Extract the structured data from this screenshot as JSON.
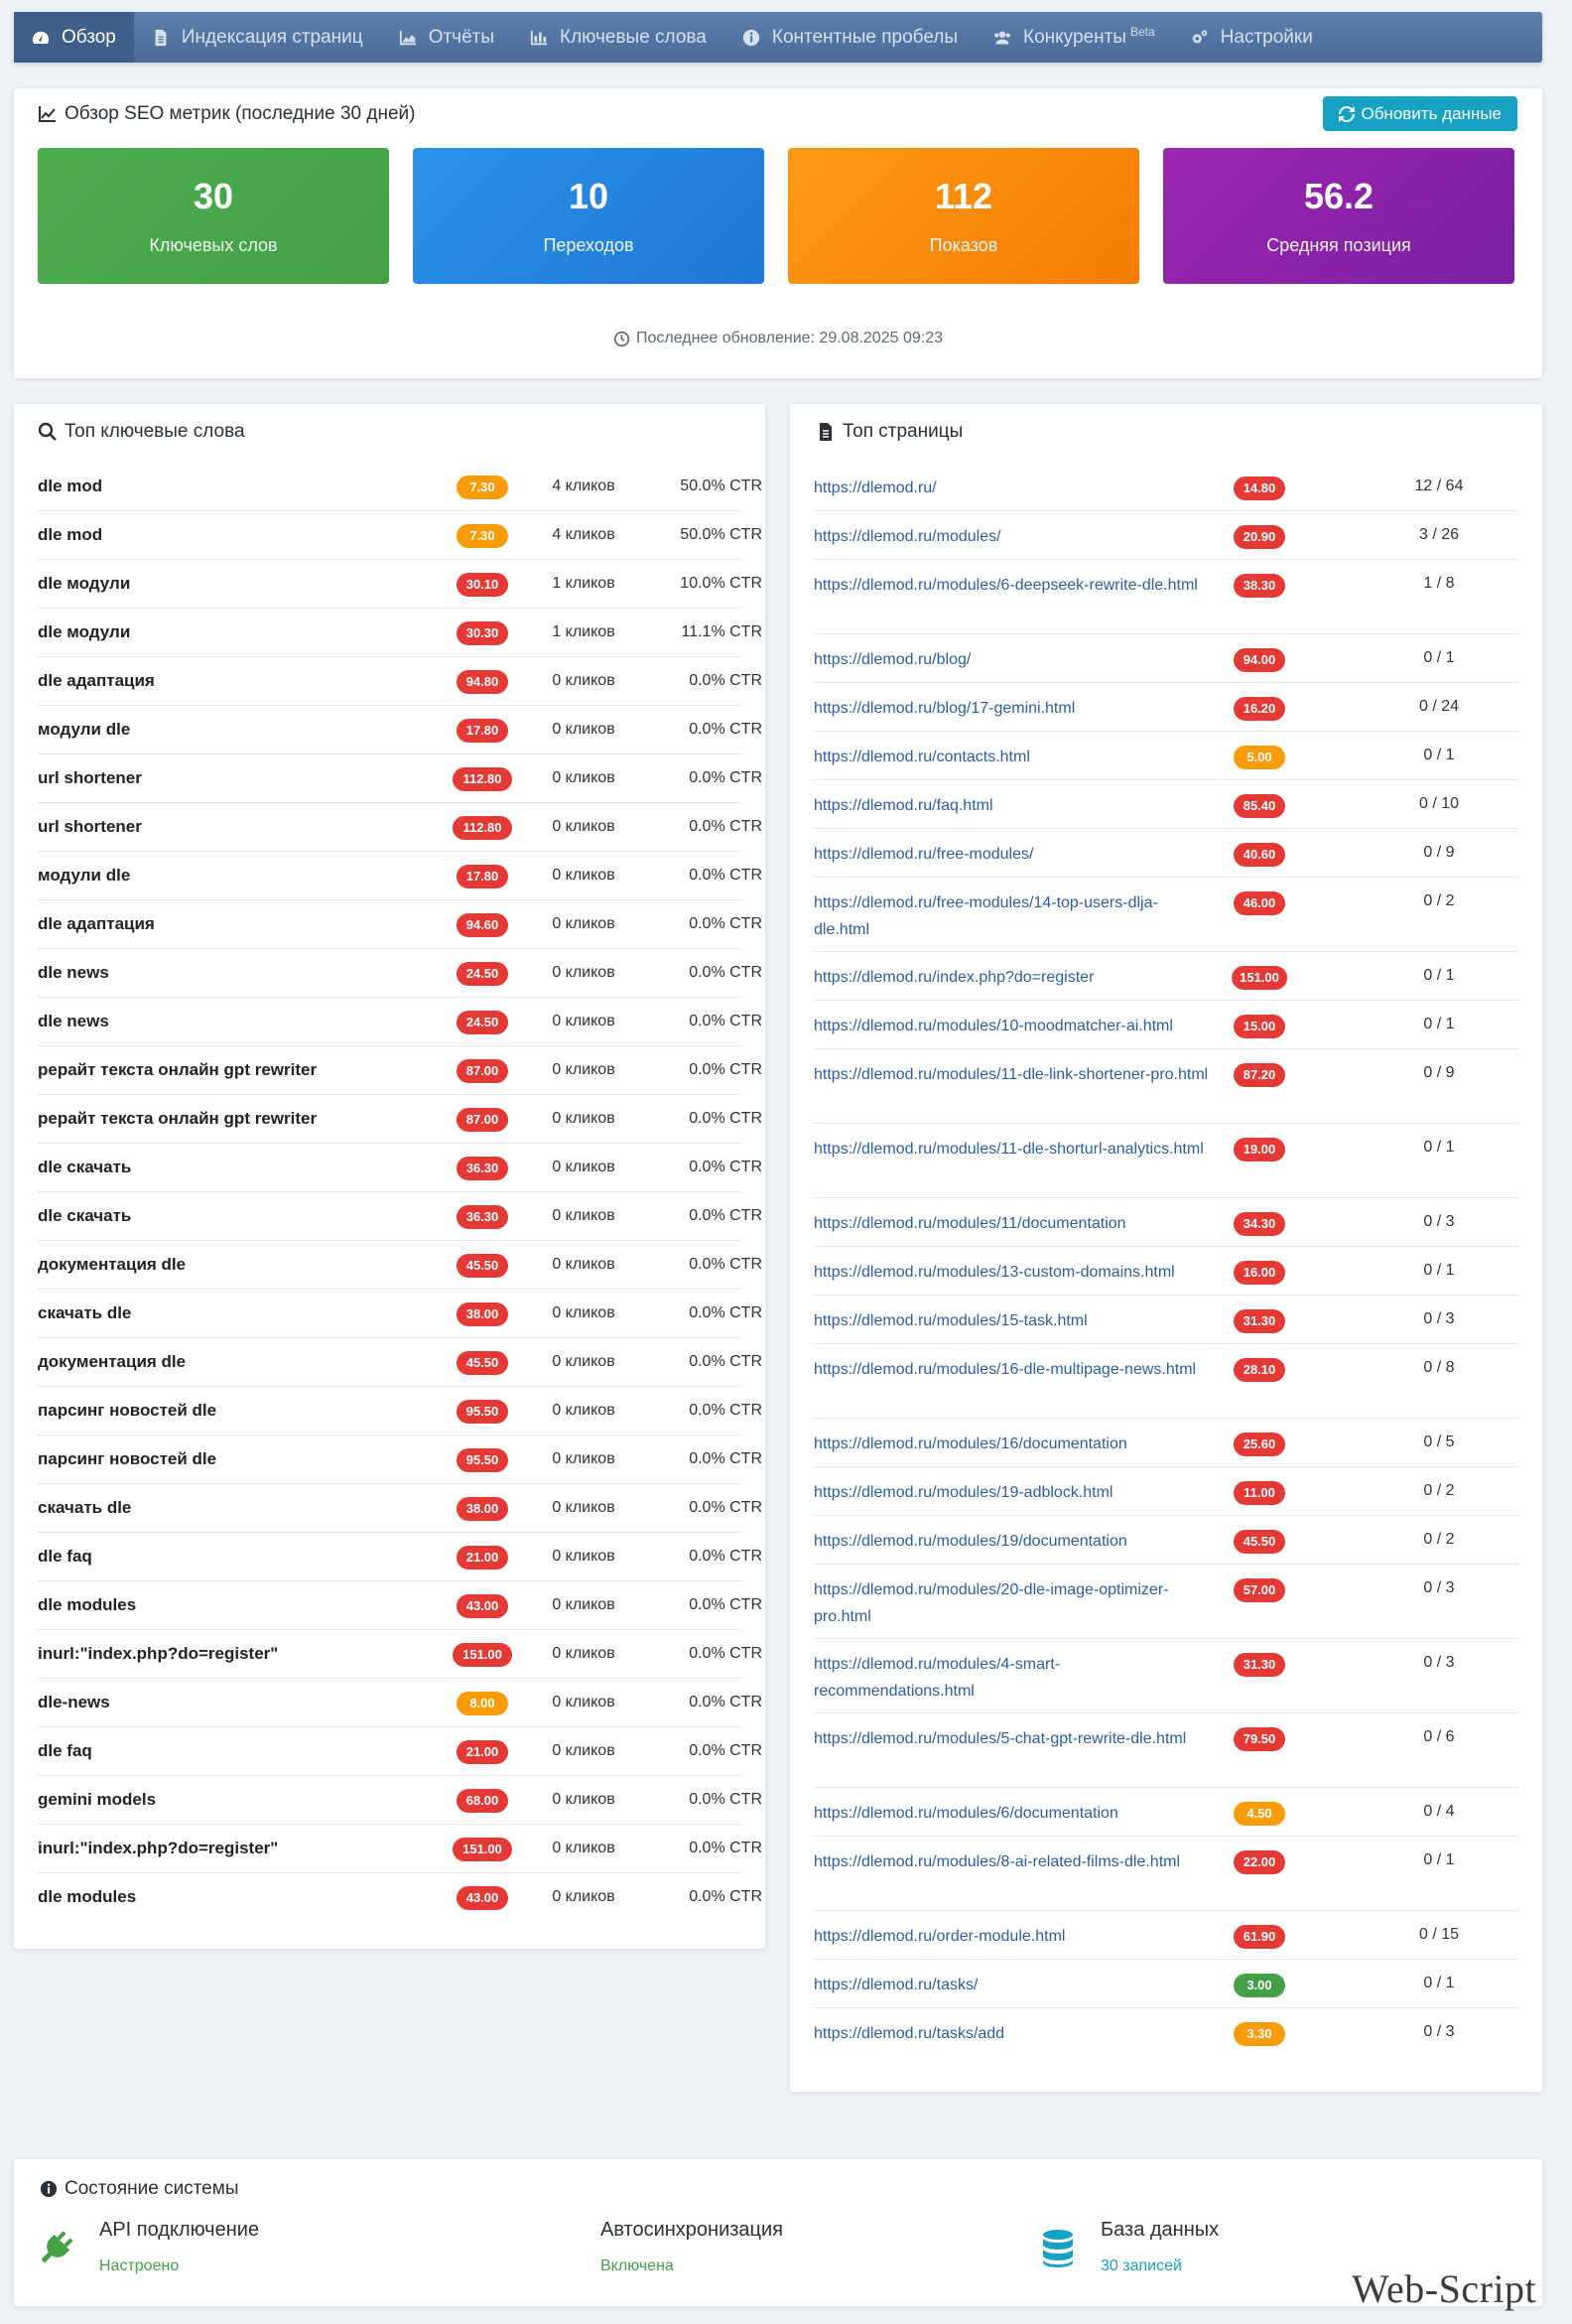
{
  "nav": {
    "items": [
      {
        "label": "Обзор",
        "icon": "dashboard-icon",
        "active": true
      },
      {
        "label": "Индексация страниц",
        "icon": "file-icon"
      },
      {
        "label": "Отчёты",
        "icon": "area-chart-icon"
      },
      {
        "label": "Ключевые слова",
        "icon": "bar-chart-icon"
      },
      {
        "label": "Контентные пробелы",
        "icon": "info-circle-icon"
      },
      {
        "label": "Конкуренты",
        "icon": "users-icon",
        "sup": "Beta"
      },
      {
        "label": "Настройки",
        "icon": "cogs-icon"
      }
    ]
  },
  "metrics": {
    "title": "Обзор SEO метрик (последние 30 дней)",
    "refresh_label": "Обновить данные",
    "updated": "Последнее обновление: 29.08.2025 09:23",
    "cards": [
      {
        "value": "30",
        "label": "Ключевых слов",
        "color_from": "#4cae4f",
        "color_to": "#43a047"
      },
      {
        "value": "10",
        "label": "Переходов",
        "color_from": "#2a93e8",
        "color_to": "#1e78d3"
      },
      {
        "value": "112",
        "label": "Показов",
        "color_from": "#ff9a17",
        "color_to": "#f57c00"
      },
      {
        "value": "56.2",
        "label": "Средняя позиция",
        "color_from": "#9c27b0",
        "color_to": "#7b1fa2"
      }
    ]
  },
  "colors": {
    "red": "#e53935",
    "orange": "#fb9c06",
    "green": "#43a047",
    "link": "#2a5ea7"
  },
  "keywords": {
    "title": "Топ ключевые слова",
    "rows": [
      {
        "name": "dle mod",
        "pos": "7.30",
        "clicks": "4 кликов",
        "ctr": "50.0% CTR",
        "color": "orange"
      },
      {
        "name": "dle mod",
        "pos": "7.30",
        "clicks": "4 кликов",
        "ctr": "50.0% CTR",
        "color": "orange"
      },
      {
        "name": "dle модули",
        "pos": "30.10",
        "clicks": "1 кликов",
        "ctr": "10.0% CTR",
        "color": "red"
      },
      {
        "name": "dle модули",
        "pos": "30.30",
        "clicks": "1 кликов",
        "ctr": "11.1% CTR",
        "color": "red"
      },
      {
        "name": "dle адаптация",
        "pos": "94.80",
        "clicks": "0 кликов",
        "ctr": "0.0% CTR",
        "color": "red"
      },
      {
        "name": "модули dle",
        "pos": "17.80",
        "clicks": "0 кликов",
        "ctr": "0.0% CTR",
        "color": "red"
      },
      {
        "name": "url shortener",
        "pos": "112.80",
        "clicks": "0 кликов",
        "ctr": "0.0% CTR",
        "color": "red"
      },
      {
        "name": "url shortener",
        "pos": "112.80",
        "clicks": "0 кликов",
        "ctr": "0.0% CTR",
        "color": "red"
      },
      {
        "name": "модули dle",
        "pos": "17.80",
        "clicks": "0 кликов",
        "ctr": "0.0% CTR",
        "color": "red"
      },
      {
        "name": "dle адаптация",
        "pos": "94.60",
        "clicks": "0 кликов",
        "ctr": "0.0% CTR",
        "color": "red"
      },
      {
        "name": "dle news",
        "pos": "24.50",
        "clicks": "0 кликов",
        "ctr": "0.0% CTR",
        "color": "red"
      },
      {
        "name": "dle news",
        "pos": "24.50",
        "clicks": "0 кликов",
        "ctr": "0.0% CTR",
        "color": "red"
      },
      {
        "name": "рерайт текста онлайн gpt rewriter",
        "pos": "87.00",
        "clicks": "0 кликов",
        "ctr": "0.0% CTR",
        "color": "red"
      },
      {
        "name": "рерайт текста онлайн gpt rewriter",
        "pos": "87.00",
        "clicks": "0 кликов",
        "ctr": "0.0% CTR",
        "color": "red"
      },
      {
        "name": "dle скачать",
        "pos": "36.30",
        "clicks": "0 кликов",
        "ctr": "0.0% CTR",
        "color": "red"
      },
      {
        "name": "dle скачать",
        "pos": "36.30",
        "clicks": "0 кликов",
        "ctr": "0.0% CTR",
        "color": "red"
      },
      {
        "name": "документация dle",
        "pos": "45.50",
        "clicks": "0 кликов",
        "ctr": "0.0% CTR",
        "color": "red"
      },
      {
        "name": "скачать dle",
        "pos": "38.00",
        "clicks": "0 кликов",
        "ctr": "0.0% CTR",
        "color": "red"
      },
      {
        "name": "документация dle",
        "pos": "45.50",
        "clicks": "0 кликов",
        "ctr": "0.0% CTR",
        "color": "red"
      },
      {
        "name": "парсинг новостей dle",
        "pos": "95.50",
        "clicks": "0 кликов",
        "ctr": "0.0% CTR",
        "color": "red"
      },
      {
        "name": "парсинг новостей dle",
        "pos": "95.50",
        "clicks": "0 кликов",
        "ctr": "0.0% CTR",
        "color": "red"
      },
      {
        "name": "скачать dle",
        "pos": "38.00",
        "clicks": "0 кликов",
        "ctr": "0.0% CTR",
        "color": "red"
      },
      {
        "name": "dle faq",
        "pos": "21.00",
        "clicks": "0 кликов",
        "ctr": "0.0% CTR",
        "color": "red"
      },
      {
        "name": "dle modules",
        "pos": "43.00",
        "clicks": "0 кликов",
        "ctr": "0.0% CTR",
        "color": "red"
      },
      {
        "name": "inurl:\"index.php?do=register\"",
        "pos": "151.00",
        "clicks": "0 кликов",
        "ctr": "0.0% CTR",
        "color": "red"
      },
      {
        "name": "dle-news",
        "pos": "8.00",
        "clicks": "0 кликов",
        "ctr": "0.0% CTR",
        "color": "orange"
      },
      {
        "name": "dle faq",
        "pos": "21.00",
        "clicks": "0 кликов",
        "ctr": "0.0% CTR",
        "color": "red"
      },
      {
        "name": "gemini models",
        "pos": "68.00",
        "clicks": "0 кликов",
        "ctr": "0.0% CTR",
        "color": "red"
      },
      {
        "name": "inurl:\"index.php?do=register\"",
        "pos": "151.00",
        "clicks": "0 кликов",
        "ctr": "0.0% CTR",
        "color": "red"
      },
      {
        "name": "dle modules",
        "pos": "43.00",
        "clicks": "0 кликов",
        "ctr": "0.0% CTR",
        "color": "red"
      }
    ]
  },
  "pages": {
    "title": "Топ страницы",
    "rows": [
      {
        "url": "https://dlemod.ru/",
        "pos": "14.80",
        "ratio": "12 / 64",
        "color": "red"
      },
      {
        "url": "https://dlemod.ru/modules/",
        "pos": "20.90",
        "ratio": "3 / 26",
        "color": "red"
      },
      {
        "url": "https://dlemod.ru/modules/6-deepseek-rewrite-dle.html",
        "pos": "38.30",
        "ratio": "1 / 8",
        "color": "red"
      },
      {
        "url": "https://dlemod.ru/blog/",
        "pos": "94.00",
        "ratio": "0 / 1",
        "color": "red"
      },
      {
        "url": "https://dlemod.ru/blog/17-gemini.html",
        "pos": "16.20",
        "ratio": "0 / 24",
        "color": "red"
      },
      {
        "url": "https://dlemod.ru/contacts.html",
        "pos": "5.00",
        "ratio": "0 / 1",
        "color": "orange"
      },
      {
        "url": "https://dlemod.ru/faq.html",
        "pos": "85.40",
        "ratio": "0 / 10",
        "color": "red"
      },
      {
        "url": "https://dlemod.ru/free-modules/",
        "pos": "40.60",
        "ratio": "0 / 9",
        "color": "red"
      },
      {
        "url": "https://dlemod.ru/free-modules/14-top-users-dlja-dle.html",
        "pos": "46.00",
        "ratio": "0 / 2",
        "color": "red"
      },
      {
        "url": "https://dlemod.ru/index.php?do=register",
        "pos": "151.00",
        "ratio": "0 / 1",
        "color": "red"
      },
      {
        "url": "https://dlemod.ru/modules/10-moodmatcher-ai.html",
        "pos": "15.00",
        "ratio": "0 / 1",
        "color": "red"
      },
      {
        "url": "https://dlemod.ru/modules/11-dle-link-shortener-pro.html",
        "pos": "87.20",
        "ratio": "0 / 9",
        "color": "red"
      },
      {
        "url": "https://dlemod.ru/modules/11-dle-shorturl-analytics.html",
        "pos": "19.00",
        "ratio": "0 / 1",
        "color": "red"
      },
      {
        "url": "https://dlemod.ru/modules/11/documentation",
        "pos": "34.30",
        "ratio": "0 / 3",
        "color": "red"
      },
      {
        "url": "https://dlemod.ru/modules/13-custom-domains.html",
        "pos": "16.00",
        "ratio": "0 / 1",
        "color": "red"
      },
      {
        "url": "https://dlemod.ru/modules/15-task.html",
        "pos": "31.30",
        "ratio": "0 / 3",
        "color": "red"
      },
      {
        "url": "https://dlemod.ru/modules/16-dle-multipage-news.html",
        "pos": "28.10",
        "ratio": "0 / 8",
        "color": "red"
      },
      {
        "url": "https://dlemod.ru/modules/16/documentation",
        "pos": "25.60",
        "ratio": "0 / 5",
        "color": "red"
      },
      {
        "url": "https://dlemod.ru/modules/19-adblock.html",
        "pos": "11.00",
        "ratio": "0 / 2",
        "color": "red"
      },
      {
        "url": "https://dlemod.ru/modules/19/documentation",
        "pos": "45.50",
        "ratio": "0 / 2",
        "color": "red"
      },
      {
        "url": "https://dlemod.ru/modules/20-dle-image-optimizer-pro.html",
        "pos": "57.00",
        "ratio": "0 / 3",
        "color": "red"
      },
      {
        "url": "https://dlemod.ru/modules/4-smart-recommendations.html",
        "pos": "31.30",
        "ratio": "0 / 3",
        "color": "red"
      },
      {
        "url": "https://dlemod.ru/modules/5-chat-gpt-rewrite-dle.html",
        "pos": "79.50",
        "ratio": "0 / 6",
        "color": "red"
      },
      {
        "url": "https://dlemod.ru/modules/6/documentation",
        "pos": "4.50",
        "ratio": "0 / 4",
        "color": "orange"
      },
      {
        "url": "https://dlemod.ru/modules/8-ai-related-films-dle.html",
        "pos": "22.00",
        "ratio": "0 / 1",
        "color": "red"
      },
      {
        "url": "https://dlemod.ru/order-module.html",
        "pos": "61.90",
        "ratio": "0 / 15",
        "color": "red"
      },
      {
        "url": "https://dlemod.ru/tasks/",
        "pos": "3.00",
        "ratio": "0 / 1",
        "color": "green"
      },
      {
        "url": "https://dlemod.ru/tasks/add",
        "pos": "3.30",
        "ratio": "0 / 3",
        "color": "orange"
      }
    ]
  },
  "status": {
    "title": "Состояние системы",
    "items": [
      {
        "title": "API подключение",
        "value": "Настроено",
        "icon": "plug-icon",
        "color": "#43a047"
      },
      {
        "title": "Автосинхронизация",
        "value": "Включена",
        "icon": "",
        "color": "#43a047"
      },
      {
        "title": "База данных",
        "value": "30 записей",
        "icon": "database-icon",
        "color": "#17a2c4"
      }
    ]
  },
  "watermark": "Web-Script"
}
